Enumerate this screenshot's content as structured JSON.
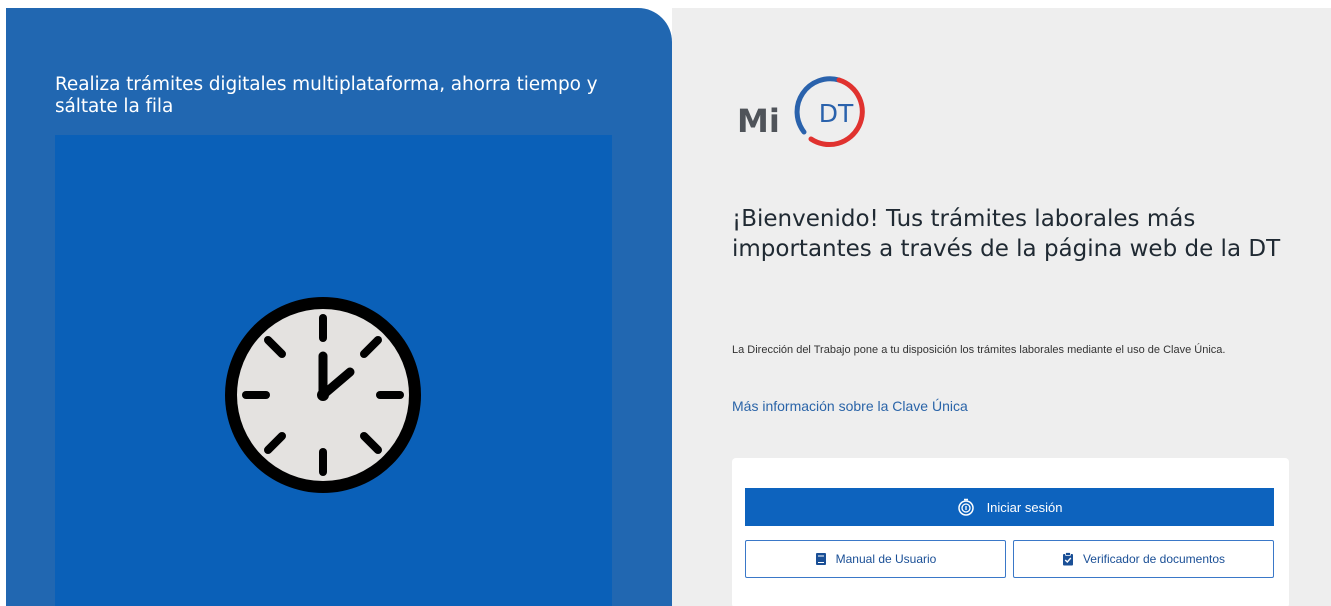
{
  "hero": {
    "tagline": "Realiza trámites digitales multiplataforma, ahorra tiempo y sáltate la fila",
    "media_icon": "clock-icon"
  },
  "logo": {
    "prefix": "Mi",
    "initials": "DT"
  },
  "welcome": {
    "title": "¡Bienvenido! Tus trámites laborales más importantes a través de la página web de la DT",
    "description": "La Dirección del Trabajo pone a tu disposición los trámites laborales mediante el uso de Clave Única.",
    "info_link": "Más información sobre la Clave Única"
  },
  "actions": {
    "login_label": "Iniciar sesión",
    "login_icon": "fingerprint-icon",
    "manual_label": "Manual de Usuario",
    "manual_icon": "book-icon",
    "verify_label": "Verificador de documentos",
    "verify_icon": "clipboard-check-icon"
  },
  "colors": {
    "left_panel": "#2167b1",
    "media_box": "#0a60b8",
    "right_panel": "#eeeeee",
    "primary_button": "#0d63be",
    "link": "#2a64a8",
    "logo_blue": "#2a62ac",
    "logo_red": "#e0322f"
  }
}
